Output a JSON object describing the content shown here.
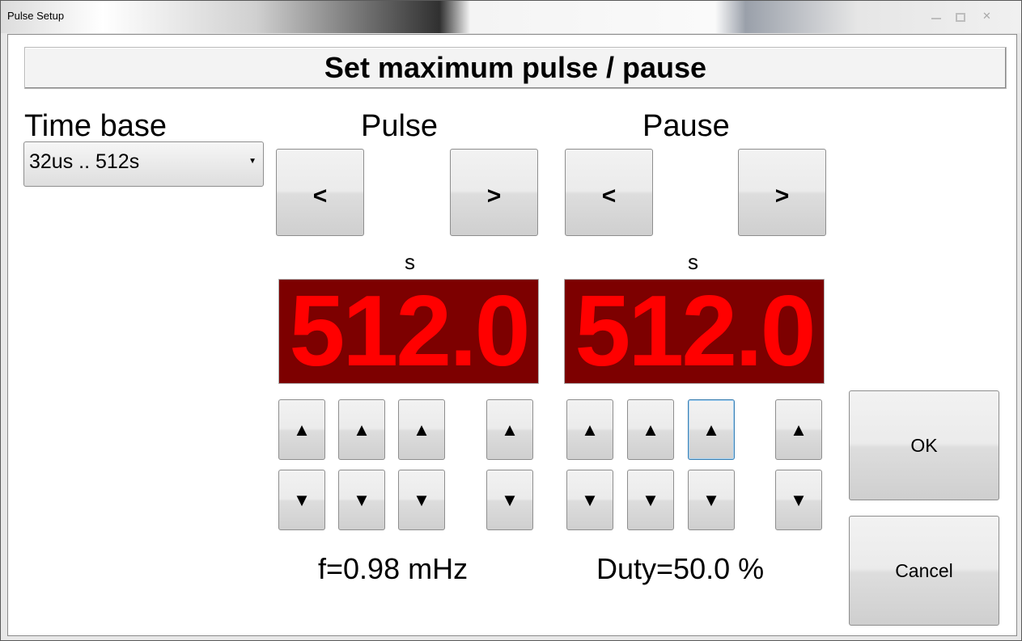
{
  "window": {
    "title": "Pulse Setup"
  },
  "header": {
    "title": "Set maximum pulse / pause"
  },
  "time_base": {
    "label": "Time base",
    "selected": "32us .. 512s"
  },
  "pulse": {
    "label": "Pulse",
    "prev": "<",
    "next": ">",
    "unit": "s",
    "value": "512.0",
    "up": "▲",
    "down": "▼"
  },
  "pause": {
    "label": "Pause",
    "prev": "<",
    "next": ">",
    "unit": "s",
    "value": "512.0",
    "up": "▲",
    "down": "▼"
  },
  "frequency": "f=0.98 mHz",
  "duty": "Duty=50.0 %",
  "buttons": {
    "ok": "OK",
    "cancel": "Cancel"
  }
}
